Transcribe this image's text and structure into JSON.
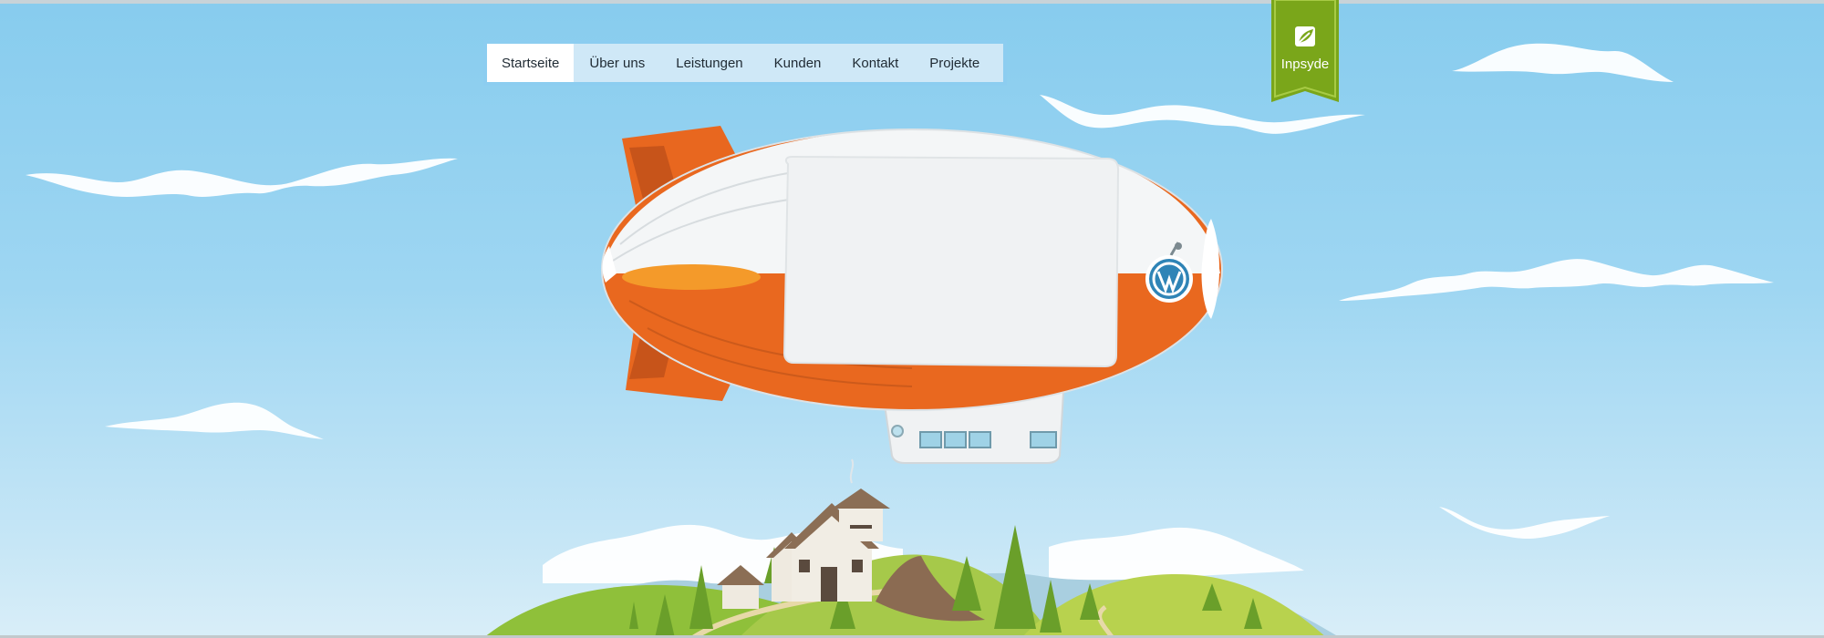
{
  "nav": {
    "items": [
      {
        "label": "Startseite",
        "active": true
      },
      {
        "label": "Über uns",
        "active": false
      },
      {
        "label": "Leistungen",
        "active": false
      },
      {
        "label": "Kunden",
        "active": false
      },
      {
        "label": "Kontakt",
        "active": false
      },
      {
        "label": "Projekte",
        "active": false
      }
    ]
  },
  "brand": {
    "name": "Inpsyde",
    "icon": "leaf-icon",
    "color": "#7aa61a"
  },
  "colors": {
    "sky": "#87ccee",
    "blimp_accent": "#ee6e22",
    "blimp_body": "#f4f6f7"
  }
}
